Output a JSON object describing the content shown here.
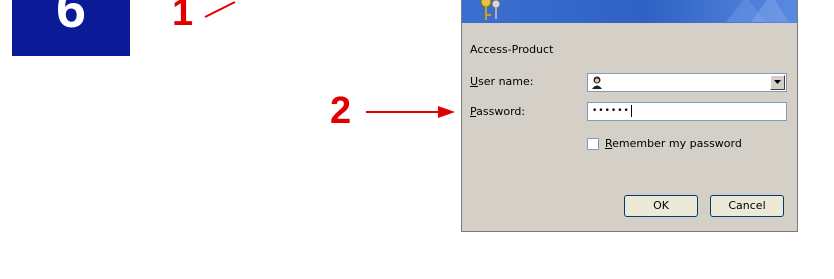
{
  "step": {
    "number": "6"
  },
  "callouts": {
    "one": "1",
    "two": "2"
  },
  "colors": {
    "step_box": "#0b1a96",
    "callout": "#e00000",
    "banner": "#3a6fd0",
    "dialog_bg": "#d4d0c8"
  },
  "dialog": {
    "product": "Access-Product",
    "user_label_hotkey": "U",
    "user_label_rest": "ser name:",
    "password_label_hotkey": "P",
    "password_label_rest": "assword:",
    "password_mask": "••••••",
    "remember_hotkey": "R",
    "remember_rest": "emember my password",
    "remember_checked": false,
    "ok_label": "OK",
    "cancel_label": "Cancel",
    "icons": {
      "banner": "keys-icon",
      "user": "user-icon",
      "dropdown": "chevron-down-icon"
    }
  }
}
